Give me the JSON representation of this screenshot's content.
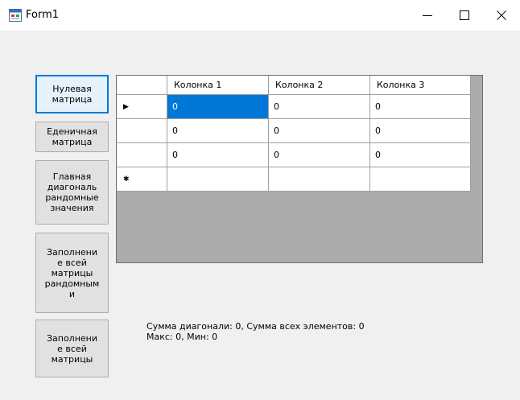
{
  "window": {
    "title": "Form1"
  },
  "buttons": {
    "zero_matrix": "Нулевая\nматрица",
    "identity_matrix": "Еденичная\nматрица",
    "main_diag_random": "Главная\nдиагональ\nрандомные\nзначения",
    "fill_all_random": "Заполнени\nе всей\nматрицы\nрандомным\nи",
    "fill_all": "Заполнени\nе всей\nматрицы"
  },
  "grid": {
    "columns": [
      "Колонка 1",
      "Колонка 2",
      "Колонка 3"
    ],
    "rows": [
      {
        "indicator": "current-row",
        "cells": [
          "0",
          "0",
          "0"
        ]
      },
      {
        "indicator": "",
        "cells": [
          "0",
          "0",
          "0"
        ]
      },
      {
        "indicator": "",
        "cells": [
          "0",
          "0",
          "0"
        ]
      },
      {
        "indicator": "new-row",
        "cells": [
          "",
          "",
          ""
        ]
      }
    ],
    "selected_cell": "row1-col1",
    "colors": {
      "selection": "#0078d7",
      "background": "#ababab"
    }
  },
  "summary": {
    "line1": "Сумма диагонали: 0, Сумма всех элементов: 0",
    "line2": "Макс: 0, Мин: 0"
  }
}
